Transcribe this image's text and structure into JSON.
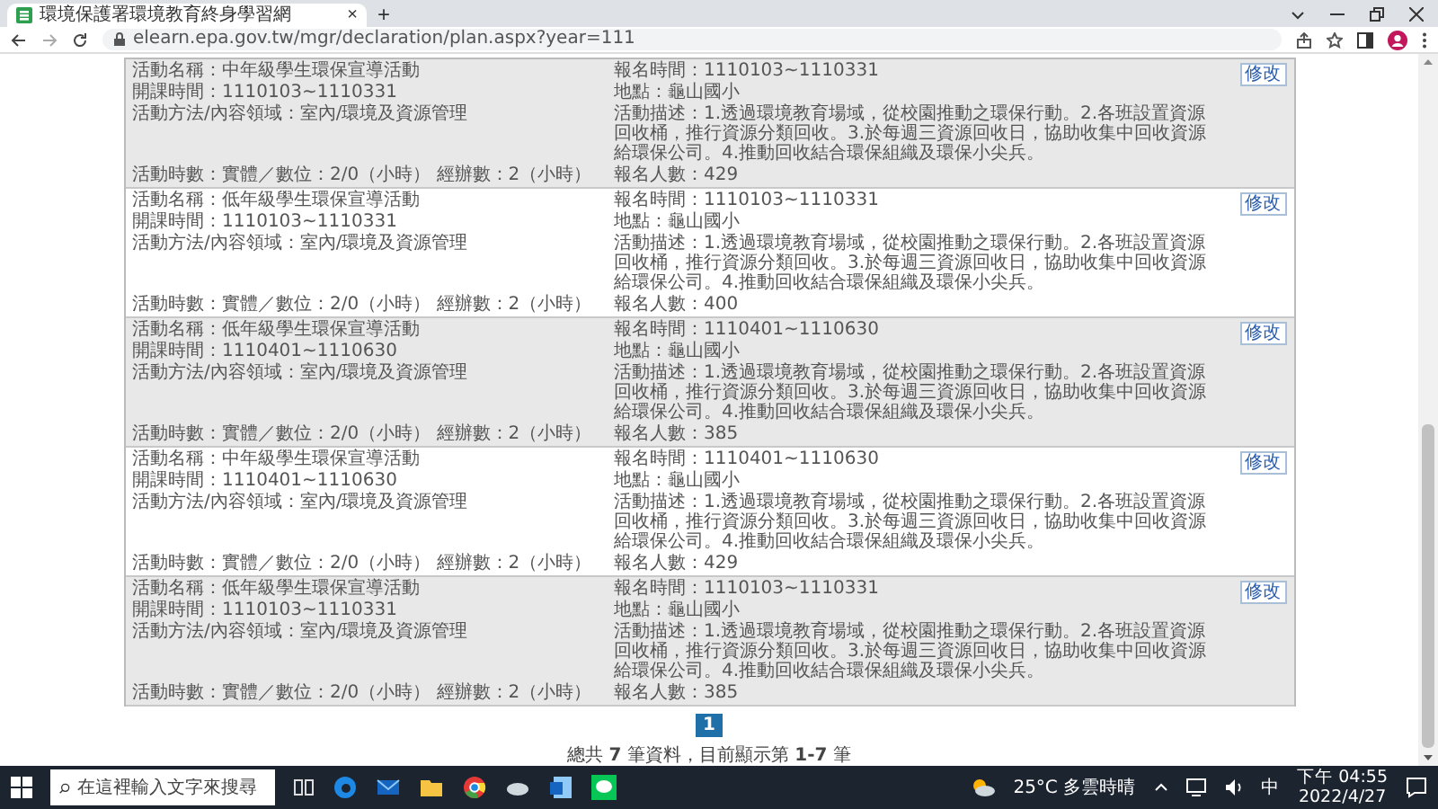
{
  "browser": {
    "tab_title": "環境保護署環境教育終身學習網",
    "tab_close": "×",
    "new_tab": "+",
    "url": "elearn.epa.gov.tw/mgr/declaration/plan.aspx?year=111"
  },
  "records": [
    {
      "name": "活動名稱：中年級學生環保宣導活動",
      "registration": "報名時間：1110103~1110331",
      "period": "開課時間：1110103~1110331",
      "location": "地點：龜山國小",
      "method": "活動方法/內容領域：室內/環境及資源管理",
      "description": "活動描述：1.透過環境教育場域，從校園推動之環保行動。2.各班設置資源回收桶，推行資源分類回收。3.於每週三資源回收日，協助收集中回收資源給環保公司。4.推動回收結合環保組織及環保小尖兵。",
      "hours": "活動時數：實體／數位：2/0（小時） 經辦數：2（小時）",
      "enrolled": "報名人數：429",
      "button": "修改"
    },
    {
      "name": "活動名稱：低年級學生環保宣導活動",
      "registration": "報名時間：1110103~1110331",
      "period": "開課時間：1110103~1110331",
      "location": "地點：龜山國小",
      "method": "活動方法/內容領域：室內/環境及資源管理",
      "description": "活動描述：1.透過環境教育場域，從校園推動之環保行動。2.各班設置資源回收桶，推行資源分類回收。3.於每週三資源回收日，協助收集中回收資源給環保公司。4.推動回收結合環保組織及環保小尖兵。",
      "hours": "活動時數：實體／數位：2/0（小時） 經辦數：2（小時）",
      "enrolled": "報名人數：400",
      "button": "修改"
    },
    {
      "name": "活動名稱：低年級學生環保宣導活動",
      "registration": "報名時間：1110401~1110630",
      "period": "開課時間：1110401~1110630",
      "location": "地點：龜山國小",
      "method": "活動方法/內容領域：室內/環境及資源管理",
      "description": "活動描述：1.透過環境教育場域，從校園推動之環保行動。2.各班設置資源回收桶，推行資源分類回收。3.於每週三資源回收日，協助收集中回收資源給環保公司。4.推動回收結合環保組織及環保小尖兵。",
      "hours": "活動時數：實體／數位：2/0（小時） 經辦數：2（小時）",
      "enrolled": "報名人數：385",
      "button": "修改"
    },
    {
      "name": "活動名稱：中年級學生環保宣導活動",
      "registration": "報名時間：1110401~1110630",
      "period": "開課時間：1110401~1110630",
      "location": "地點：龜山國小",
      "method": "活動方法/內容領域：室內/環境及資源管理",
      "description": "活動描述：1.透過環境教育場域，從校園推動之環保行動。2.各班設置資源回收桶，推行資源分類回收。3.於每週三資源回收日，協助收集中回收資源給環保公司。4.推動回收結合環保組織及環保小尖兵。",
      "hours": "活動時數：實體／數位：2/0（小時） 經辦數：2（小時）",
      "enrolled": "報名人數：429",
      "button": "修改"
    },
    {
      "name": "活動名稱：低年級學生環保宣導活動",
      "registration": "報名時間：1110103~1110331",
      "period": "開課時間：1110103~1110331",
      "location": "地點：龜山國小",
      "method": "活動方法/內容領域：室內/環境及資源管理",
      "description": "活動描述：1.透過環境教育場域，從校園推動之環保行動。2.各班設置資源回收桶，推行資源分類回收。3.於每週三資源回收日，協助收集中回收資源給環保公司。4.推動回收結合環保組織及環保小尖兵。",
      "hours": "活動時數：實體／數位：2/0（小時） 經辦數：2（小時）",
      "enrolled": "報名人數：385",
      "button": "修改"
    }
  ],
  "pager": {
    "pages": [
      {
        "label": "1",
        "selected": true
      }
    ],
    "summary": "總共 **7** 筆資料，目前顯示第 **1-7** 筆"
  },
  "taskbar": {
    "search_placeholder": "在這裡輸入文字來搜尋",
    "weather": "25°C 多雲時晴",
    "ime": "中",
    "time": "下午 04:55",
    "date": "2022/4/27"
  }
}
